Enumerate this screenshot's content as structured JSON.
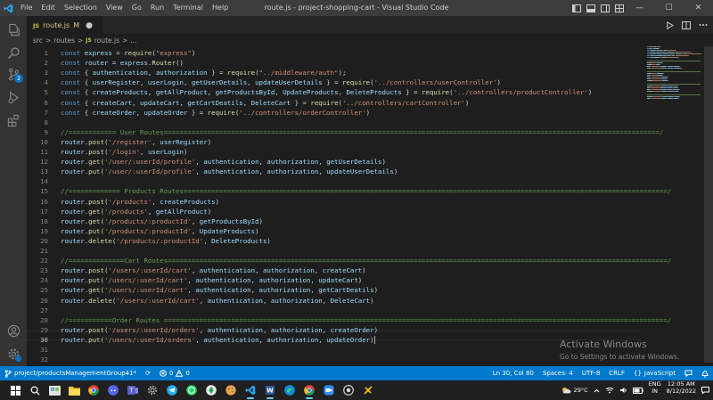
{
  "titlebar": {
    "menu": [
      "File",
      "Edit",
      "Selection",
      "View",
      "Go",
      "Run",
      "Terminal",
      "Help"
    ],
    "title": "route.js - project-shopping-cart - Visual Studio Code",
    "controls": {
      "minimize": "—",
      "maximize": "☐",
      "close": "✕"
    }
  },
  "activitybar": {
    "items": [
      "explorer-icon",
      "search-icon",
      "source-control-icon",
      "run-debug-icon",
      "extensions-icon"
    ],
    "scm_badge": "2",
    "bottom": [
      "account-icon",
      "settings-gear-icon"
    ]
  },
  "tab": {
    "lang": "JS",
    "name": "route.js",
    "modified": "M"
  },
  "breadcrumb": {
    "p1": "src",
    "sep": ">",
    "p2": "routes",
    "lang": "JS",
    "p3": "route.js",
    "p4": "..."
  },
  "editor": {
    "cursor_line": 30,
    "lines": [
      {
        "n": "1",
        "t": [
          [
            "k",
            "const "
          ],
          [
            "v",
            "express"
          ],
          [
            "p",
            " = "
          ],
          [
            "f",
            "require"
          ],
          [
            "p",
            "("
          ],
          [
            "s",
            "\"express\""
          ],
          [
            "p",
            ")"
          ]
        ]
      },
      {
        "n": "2",
        "t": [
          [
            "k",
            "const "
          ],
          [
            "v",
            "router"
          ],
          [
            "p",
            " = "
          ],
          [
            "v",
            "express"
          ],
          [
            "p",
            "."
          ],
          [
            "f",
            "Router"
          ],
          [
            "p",
            "()"
          ]
        ]
      },
      {
        "n": "3",
        "t": [
          [
            "k",
            "const "
          ],
          [
            "p",
            "{ "
          ],
          [
            "v",
            "authentication"
          ],
          [
            "p",
            ", "
          ],
          [
            "v",
            "authorization"
          ],
          [
            "p",
            " } = "
          ],
          [
            "f",
            "require"
          ],
          [
            "p",
            "("
          ],
          [
            "s",
            "\"../middleware/auth\""
          ],
          [
            "p",
            ");"
          ]
        ]
      },
      {
        "n": "4",
        "t": [
          [
            "k",
            "const "
          ],
          [
            "p",
            "{ "
          ],
          [
            "v",
            "userRegister"
          ],
          [
            "p",
            ", "
          ],
          [
            "v",
            "userLogin"
          ],
          [
            "p",
            ", "
          ],
          [
            "v",
            "getUserDetails"
          ],
          [
            "p",
            ", "
          ],
          [
            "v",
            "updateUserDetails"
          ],
          [
            "p",
            " } = "
          ],
          [
            "f",
            "require"
          ],
          [
            "p",
            "("
          ],
          [
            "s",
            "'../controllers/userController'"
          ],
          [
            "p",
            ")"
          ]
        ]
      },
      {
        "n": "5",
        "t": [
          [
            "k",
            "const "
          ],
          [
            "p",
            "{ "
          ],
          [
            "v",
            "createProducts"
          ],
          [
            "p",
            ", "
          ],
          [
            "v",
            "getAllProduct"
          ],
          [
            "p",
            ", "
          ],
          [
            "v",
            "getProductsById"
          ],
          [
            "p",
            ", "
          ],
          [
            "v",
            "UpdateProducts"
          ],
          [
            "p",
            ", "
          ],
          [
            "v",
            "DeleteProducts"
          ],
          [
            "p",
            " } = "
          ],
          [
            "f",
            "require"
          ],
          [
            "p",
            "("
          ],
          [
            "s",
            "'../controllers/productController'"
          ],
          [
            "p",
            ")"
          ]
        ]
      },
      {
        "n": "6",
        "t": [
          [
            "k",
            "const "
          ],
          [
            "p",
            "{ "
          ],
          [
            "v",
            "createCart"
          ],
          [
            "p",
            ", "
          ],
          [
            "v",
            "updateCart"
          ],
          [
            "p",
            ", "
          ],
          [
            "v",
            "getCartDeatils"
          ],
          [
            "p",
            ", "
          ],
          [
            "v",
            "DeleteCart"
          ],
          [
            "p",
            " } = "
          ],
          [
            "f",
            "require"
          ],
          [
            "p",
            "("
          ],
          [
            "s",
            "'../controllers/cartController'"
          ],
          [
            "p",
            ")"
          ]
        ]
      },
      {
        "n": "7",
        "t": [
          [
            "k",
            "const "
          ],
          [
            "p",
            "{ "
          ],
          [
            "v",
            "createOrder"
          ],
          [
            "p",
            ", "
          ],
          [
            "v",
            "updateOrder"
          ],
          [
            "p",
            " } = "
          ],
          [
            "f",
            "require"
          ],
          [
            "p",
            "("
          ],
          [
            "s",
            "'../controllers/orderController'"
          ],
          [
            "p",
            ")"
          ]
        ]
      },
      {
        "n": "8",
        "t": []
      },
      {
        "n": "9",
        "t": [
          [
            "c",
            "//============ User Routes=============================================================================================================================/"
          ]
        ]
      },
      {
        "n": "10",
        "t": [
          [
            "v",
            "router"
          ],
          [
            "p",
            "."
          ],
          [
            "f",
            "post"
          ],
          [
            "p",
            "("
          ],
          [
            "s",
            "'/register'"
          ],
          [
            "p",
            ", "
          ],
          [
            "v",
            "userRegister"
          ],
          [
            "p",
            ")"
          ]
        ]
      },
      {
        "n": "11",
        "t": [
          [
            "v",
            "router"
          ],
          [
            "p",
            "."
          ],
          [
            "f",
            "post"
          ],
          [
            "p",
            "("
          ],
          [
            "s",
            "'/login'"
          ],
          [
            "p",
            ", "
          ],
          [
            "v",
            "userLogin"
          ],
          [
            "p",
            ")"
          ]
        ]
      },
      {
        "n": "12",
        "t": [
          [
            "v",
            "router"
          ],
          [
            "p",
            "."
          ],
          [
            "f",
            "get"
          ],
          [
            "p",
            "("
          ],
          [
            "s",
            "'/user/:userId/profile'"
          ],
          [
            "p",
            ", "
          ],
          [
            "v",
            "authentication"
          ],
          [
            "p",
            ", "
          ],
          [
            "v",
            "authorization"
          ],
          [
            "p",
            ", "
          ],
          [
            "v",
            "getUserDetails"
          ],
          [
            "p",
            ")"
          ]
        ]
      },
      {
        "n": "13",
        "t": [
          [
            "v",
            "router"
          ],
          [
            "p",
            "."
          ],
          [
            "f",
            "put"
          ],
          [
            "p",
            "("
          ],
          [
            "s",
            "'/user/:userId/profile'"
          ],
          [
            "p",
            ", "
          ],
          [
            "v",
            "authentication"
          ],
          [
            "p",
            ", "
          ],
          [
            "v",
            "authorization"
          ],
          [
            "p",
            ", "
          ],
          [
            "v",
            "updateUserDetails"
          ],
          [
            "p",
            ")"
          ]
        ]
      },
      {
        "n": "14",
        "t": []
      },
      {
        "n": "15",
        "t": [
          [
            "c",
            "//============= Products Routes==========================================================================================================================/"
          ]
        ]
      },
      {
        "n": "16",
        "t": [
          [
            "v",
            "router"
          ],
          [
            "p",
            "."
          ],
          [
            "f",
            "post"
          ],
          [
            "p",
            "("
          ],
          [
            "s",
            "'/products'"
          ],
          [
            "p",
            ", "
          ],
          [
            "v",
            "createProducts"
          ],
          [
            "p",
            ")"
          ]
        ]
      },
      {
        "n": "17",
        "t": [
          [
            "v",
            "router"
          ],
          [
            "p",
            "."
          ],
          [
            "f",
            "get"
          ],
          [
            "p",
            "("
          ],
          [
            "s",
            "'/products'"
          ],
          [
            "p",
            ", "
          ],
          [
            "v",
            "getAllProduct"
          ],
          [
            "p",
            ")"
          ]
        ]
      },
      {
        "n": "18",
        "t": [
          [
            "v",
            "router"
          ],
          [
            "p",
            "."
          ],
          [
            "f",
            "get"
          ],
          [
            "p",
            "("
          ],
          [
            "s",
            "'/products/:productId'"
          ],
          [
            "p",
            ", "
          ],
          [
            "v",
            "getProductsById"
          ],
          [
            "p",
            ")"
          ]
        ]
      },
      {
        "n": "19",
        "t": [
          [
            "v",
            "router"
          ],
          [
            "p",
            "."
          ],
          [
            "f",
            "put"
          ],
          [
            "p",
            "("
          ],
          [
            "s",
            "'/products/:productId'"
          ],
          [
            "p",
            ", "
          ],
          [
            "v",
            "UpdateProducts"
          ],
          [
            "p",
            ")"
          ]
        ]
      },
      {
        "n": "20",
        "t": [
          [
            "v",
            "router"
          ],
          [
            "p",
            "."
          ],
          [
            "f",
            "delete"
          ],
          [
            "p",
            "("
          ],
          [
            "s",
            "'/products/:productId'"
          ],
          [
            "p",
            ", "
          ],
          [
            "v",
            "DeleteProducts"
          ],
          [
            "p",
            ")"
          ]
        ]
      },
      {
        "n": "21",
        "t": []
      },
      {
        "n": "22",
        "t": [
          [
            "c",
            "//==============Cart Routes==============================================================================================================================/"
          ]
        ]
      },
      {
        "n": "23",
        "t": [
          [
            "v",
            "router"
          ],
          [
            "p",
            "."
          ],
          [
            "f",
            "post"
          ],
          [
            "p",
            "("
          ],
          [
            "s",
            "'/users/:userId/cart'"
          ],
          [
            "p",
            ", "
          ],
          [
            "v",
            "authentication"
          ],
          [
            "p",
            ", "
          ],
          [
            "v",
            "authorization"
          ],
          [
            "p",
            ", "
          ],
          [
            "v",
            "createCart"
          ],
          [
            "p",
            ")"
          ]
        ]
      },
      {
        "n": "24",
        "t": [
          [
            "v",
            "router"
          ],
          [
            "p",
            "."
          ],
          [
            "f",
            "put"
          ],
          [
            "p",
            "("
          ],
          [
            "s",
            "'/users/:userId/cart'"
          ],
          [
            "p",
            ", "
          ],
          [
            "v",
            "authentication"
          ],
          [
            "p",
            ", "
          ],
          [
            "v",
            "authorization"
          ],
          [
            "p",
            ", "
          ],
          [
            "v",
            "updateCart"
          ],
          [
            "p",
            ")"
          ]
        ]
      },
      {
        "n": "25",
        "t": [
          [
            "v",
            "router"
          ],
          [
            "p",
            "."
          ],
          [
            "f",
            "get"
          ],
          [
            "p",
            "("
          ],
          [
            "s",
            "'/users/:userId/cart'"
          ],
          [
            "p",
            ", "
          ],
          [
            "v",
            "authentication"
          ],
          [
            "p",
            ", "
          ],
          [
            "v",
            "authorization"
          ],
          [
            "p",
            ", "
          ],
          [
            "v",
            "getCartDeatils"
          ],
          [
            "p",
            ")"
          ]
        ]
      },
      {
        "n": "26",
        "t": [
          [
            "v",
            "router"
          ],
          [
            "p",
            "."
          ],
          [
            "f",
            "delete"
          ],
          [
            "p",
            "("
          ],
          [
            "s",
            "'/users/:userId/cart'"
          ],
          [
            "p",
            ", "
          ],
          [
            "v",
            "authentication"
          ],
          [
            "p",
            ", "
          ],
          [
            "v",
            "authorization"
          ],
          [
            "p",
            ", "
          ],
          [
            "v",
            "DeleteCart"
          ],
          [
            "p",
            ")"
          ]
        ]
      },
      {
        "n": "27",
        "t": []
      },
      {
        "n": "28",
        "t": [
          [
            "c",
            "//===========Order Routes ===============================================================================================================================/"
          ]
        ]
      },
      {
        "n": "29",
        "t": [
          [
            "v",
            "router"
          ],
          [
            "p",
            "."
          ],
          [
            "f",
            "post"
          ],
          [
            "p",
            "("
          ],
          [
            "s",
            "'/users/:userId/orders'"
          ],
          [
            "p",
            ", "
          ],
          [
            "v",
            "authentication"
          ],
          [
            "p",
            ", "
          ],
          [
            "v",
            "authorization"
          ],
          [
            "p",
            ", "
          ],
          [
            "v",
            "createOrder"
          ],
          [
            "p",
            ")"
          ]
        ]
      },
      {
        "n": "30",
        "t": [
          [
            "v",
            "router"
          ],
          [
            "p",
            "."
          ],
          [
            "f",
            "put"
          ],
          [
            "p",
            "("
          ],
          [
            "s",
            "'/users/:userId/orders'"
          ],
          [
            "p",
            ", "
          ],
          [
            "v",
            "authentication"
          ],
          [
            "p",
            ", "
          ],
          [
            "v",
            "authorization"
          ],
          [
            "p",
            ", "
          ],
          [
            "v",
            "updateOrder"
          ],
          [
            "p",
            ")"
          ]
        ]
      },
      {
        "n": "31",
        "t": []
      },
      {
        "n": "32",
        "t": []
      }
    ]
  },
  "watermark": {
    "line1": "Activate Windows",
    "line2": "Go to Settings to activate Windows."
  },
  "statusbar": {
    "branch": "project/productsManagementGroup41*",
    "sync": "⟳",
    "errors": "0",
    "warnings": "0",
    "position": "Ln 30, Col 80",
    "spaces": "Spaces: 4",
    "encoding": "UTF-8",
    "eol": "CRLF",
    "lang_icon": "{}",
    "language": "JavaScript"
  },
  "taskbar": {
    "apps": [
      "windows-start-icon",
      "search-icon",
      "file-manager-icon",
      "explorer-icon",
      "chrome-icon",
      "discord-icon",
      "teams-icon",
      "settings-icon",
      "telegram-icon",
      "whatsapp-icon",
      "app-icon",
      "paint-icon",
      "vscode-icon",
      "word-icon",
      "edge-icon",
      "chrome-icon",
      "zoom-icon",
      "camera-icon",
      "game-icon"
    ],
    "temp": "29°C",
    "lang": "ENG",
    "region": "IN",
    "time": "12:05 AM",
    "date": "8/12/2022"
  },
  "colors": {
    "accent": "#007acc",
    "titlebar": "#3c3c3c",
    "activitybar": "#333333",
    "editor_bg": "#1e1e1e",
    "keyword": "#569cd6",
    "variable": "#9cdcfe",
    "function": "#dcdcaa",
    "string": "#ce9178",
    "comment": "#6a9955"
  }
}
